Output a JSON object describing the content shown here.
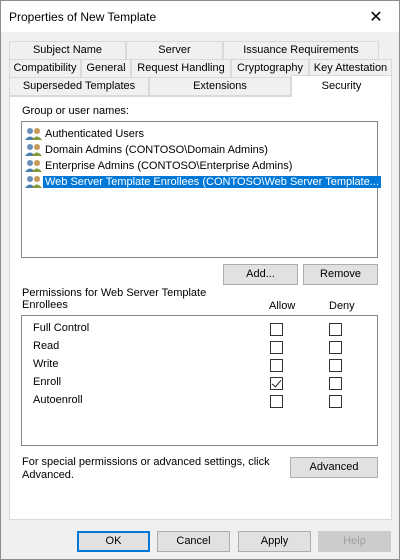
{
  "window": {
    "title": "Properties of New Template",
    "close_glyph": "✕"
  },
  "tabs": {
    "row1": [
      "Subject Name",
      "Server",
      "Issuance Requirements"
    ],
    "row2": [
      "Compatibility",
      "General",
      "Request Handling",
      "Cryptography",
      "Key Attestation"
    ],
    "row3": [
      "Superseded Templates",
      "Extensions",
      "Security"
    ],
    "selected": "Security"
  },
  "security": {
    "group_label": "Group or user names:",
    "users": [
      {
        "name": "Authenticated Users",
        "icon": "users-group-icon",
        "selected": false
      },
      {
        "name": "Domain Admins (CONTOSO\\Domain Admins)",
        "icon": "users-group-icon",
        "selected": false
      },
      {
        "name": "Enterprise Admins (CONTOSO\\Enterprise Admins)",
        "icon": "users-group-icon",
        "selected": false
      },
      {
        "name": "Web Server Template Enrollees (CONTOSO\\Web Server Template...",
        "icon": "users-group-icon",
        "selected": true
      }
    ],
    "add_button": "Add...",
    "remove_button": "Remove",
    "permissions_label_line1": "Permissions for Web Server Template",
    "permissions_label_line2": "Enrollees",
    "allow_header": "Allow",
    "deny_header": "Deny",
    "permissions": [
      {
        "name": "Full Control",
        "allow": false,
        "deny": false
      },
      {
        "name": "Read",
        "allow": false,
        "deny": false
      },
      {
        "name": "Write",
        "allow": false,
        "deny": false
      },
      {
        "name": "Enroll",
        "allow": true,
        "deny": false
      },
      {
        "name": "Autoenroll",
        "allow": false,
        "deny": false
      }
    ],
    "advanced_text_line1": "For special permissions or advanced settings, click",
    "advanced_text_line2": "Advanced.",
    "advanced_button": "Advanced"
  },
  "footer": {
    "ok": "OK",
    "cancel": "Cancel",
    "apply": "Apply",
    "help": "Help"
  },
  "colors": {
    "selection": "#0078d7",
    "dialog_bg": "#f0f0f0"
  }
}
